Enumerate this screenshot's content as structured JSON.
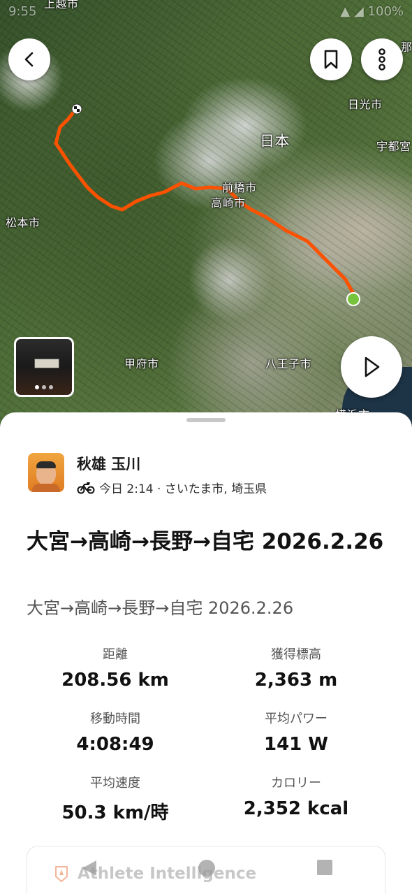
{
  "status_bar": {
    "time": "9:55",
    "icons": "▲ ◢ 100%"
  },
  "map": {
    "cities": [
      {
        "name": "上越市",
        "key": "joetsu"
      },
      {
        "name": "日光市",
        "key": "nikko"
      },
      {
        "name": "日本",
        "key": "japan"
      },
      {
        "name": "宇都宮",
        "key": "utsunomiya"
      },
      {
        "name": "前橋市",
        "key": "maebashi"
      },
      {
        "name": "高崎市",
        "key": "takasaki"
      },
      {
        "name": "松本市",
        "key": "matsumoto"
      },
      {
        "name": "甲府市",
        "key": "kofu"
      },
      {
        "name": "八王子市",
        "key": "hachioji"
      },
      {
        "name": "横浜市",
        "key": "yokohama"
      },
      {
        "name": "那",
        "key": "na"
      }
    ],
    "photo_count": 3,
    "photo_active_index": 0,
    "route_color": "#fc5200",
    "start_color": "#76c43b"
  },
  "activity": {
    "athlete_name": "秋雄 玉川",
    "meta": "今日 2:14 · さいたま市, 埼玉県",
    "activity_type_icon": "bicycle-icon",
    "title": "大宮→高崎→長野→自宅 2026.2.26",
    "subtitle": "大宮→高崎→長野→自宅 2026.2.26",
    "stats": [
      {
        "label": "距離",
        "value": "208.56 km"
      },
      {
        "label": "獲得標高",
        "value": "2,363 m"
      },
      {
        "label": "移動時間",
        "value": "4:08:49"
      },
      {
        "label": "平均パワー",
        "value": "141 W"
      },
      {
        "label": "平均速度",
        "value": "50.3 km/時"
      },
      {
        "label": "カロリー",
        "value": "2,352 kcal"
      }
    ],
    "athlete_intelligence_label": "Athlete Intelligence"
  }
}
